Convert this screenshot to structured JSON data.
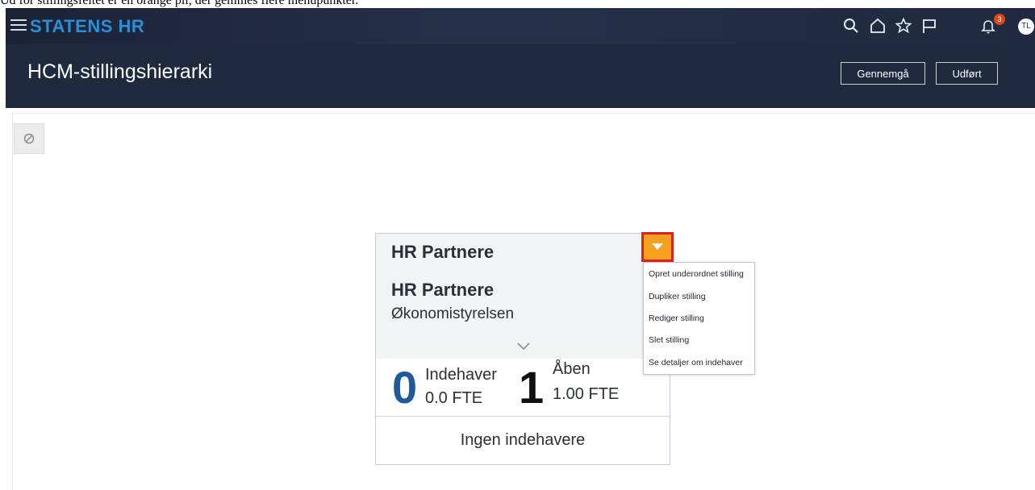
{
  "caption": "Ud for stillingsfeltet er en orange pil, der gemmes flere menupunkter.",
  "topbar": {
    "brand": "STATENS HR",
    "notification_count": "3",
    "avatar_initials": "TL",
    "icons": [
      "search-icon",
      "home-icon",
      "star-icon",
      "flag-icon",
      "bell-icon"
    ]
  },
  "header": {
    "title": "HCM-stillingshierarki",
    "review_label": "Gennemgå",
    "done_label": "Udført"
  },
  "card": {
    "title": "HR Partnere",
    "position": "HR Partnere",
    "organization": "Økonomistyrelsen",
    "incumbents_count": "0",
    "incumbents_label": "Indehaver",
    "incumbents_fte": "0.0 FTE",
    "open_count": "1",
    "open_label": "Åben",
    "open_fte": "1.00 FTE",
    "footer": "Ingen indehavere"
  },
  "menu": {
    "items": [
      "Opret underordnet stilling",
      "Dupliker stilling",
      "Rediger stilling",
      "Slet stilling",
      "Se detaljer om indehaver"
    ]
  },
  "colors": {
    "accent_orange": "#f3a01f",
    "highlight_red": "#e0201e",
    "brand_blue": "#2a8fd6",
    "incumbent_blue": "#1e5b9c"
  }
}
